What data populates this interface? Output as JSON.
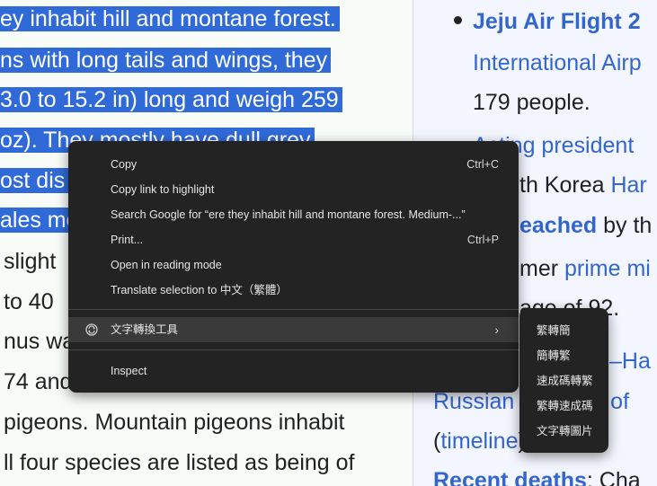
{
  "article": {
    "lines": [
      {
        "text": "ey inhabit hill and montane forest.",
        "selected": true
      },
      {
        "text": "ns with long tails and wings, they",
        "selected": true
      },
      {
        "text": "3.0 to 15.2 in) long and weigh 259",
        "selected": true
      },
      {
        "text": "oz). They mostly have dull grey",
        "selected": true
      },
      {
        "text": "ost dis",
        "selected": true
      },
      {
        "text": "ales mo",
        "selected": true
      },
      {
        "text": "slight",
        "selected": false
      },
      {
        "text": "to 40",
        "selected": false
      },
      {
        "text": "nus wa",
        "selected": false
      },
      {
        "text": "74 and",
        "selected": false
      },
      {
        "text": "pigeons. Mountain pigeons inhabit",
        "selected": false
      },
      {
        "text": "ll four species are listed as being of",
        "selected": false
      }
    ]
  },
  "sidebar": {
    "line1_bold": "Jeju Air Flight 2",
    "line2": "International Airp",
    "line3": "179 people.",
    "line4": "Acting president",
    "line5_pre": "th Korea ",
    "line5_link": "Har",
    "line6_link": "eached",
    "line6_post": " by th",
    "line7_pre": "mer ",
    "line7_link": "prime mi",
    "line8": "age of 92.",
    "line9_link": "–Ha",
    "line10_link": "Russian",
    "line10_post": "n of",
    "line11_pre": "(",
    "line11_link": "timeline",
    "line11_post": ")",
    "line12_bold": "Recent deaths",
    "line12_post": ": Cha"
  },
  "context_menu": {
    "items": [
      {
        "label": "Copy",
        "shortcut": "Ctrl+C"
      },
      {
        "label": "Copy link to highlight",
        "shortcut": ""
      },
      {
        "label": "Search Google for “ere they inhabit hill and montane forest. Medium-...”",
        "shortcut": ""
      },
      {
        "label": "Print...",
        "shortcut": "Ctrl+P"
      },
      {
        "label": "Open in reading mode",
        "shortcut": ""
      },
      {
        "label": "Translate selection to 中文（繁體）",
        "shortcut": ""
      }
    ],
    "extension_item": {
      "label": "文字轉換工具",
      "chevron": "›",
      "icon": "text-converter-icon"
    },
    "inspect": {
      "label": "Inspect"
    }
  },
  "submenu": {
    "items": [
      "繁轉簡",
      "簡轉繁",
      "速成碼轉繁",
      "繁轉速成碼",
      "文字轉圖片"
    ]
  }
}
